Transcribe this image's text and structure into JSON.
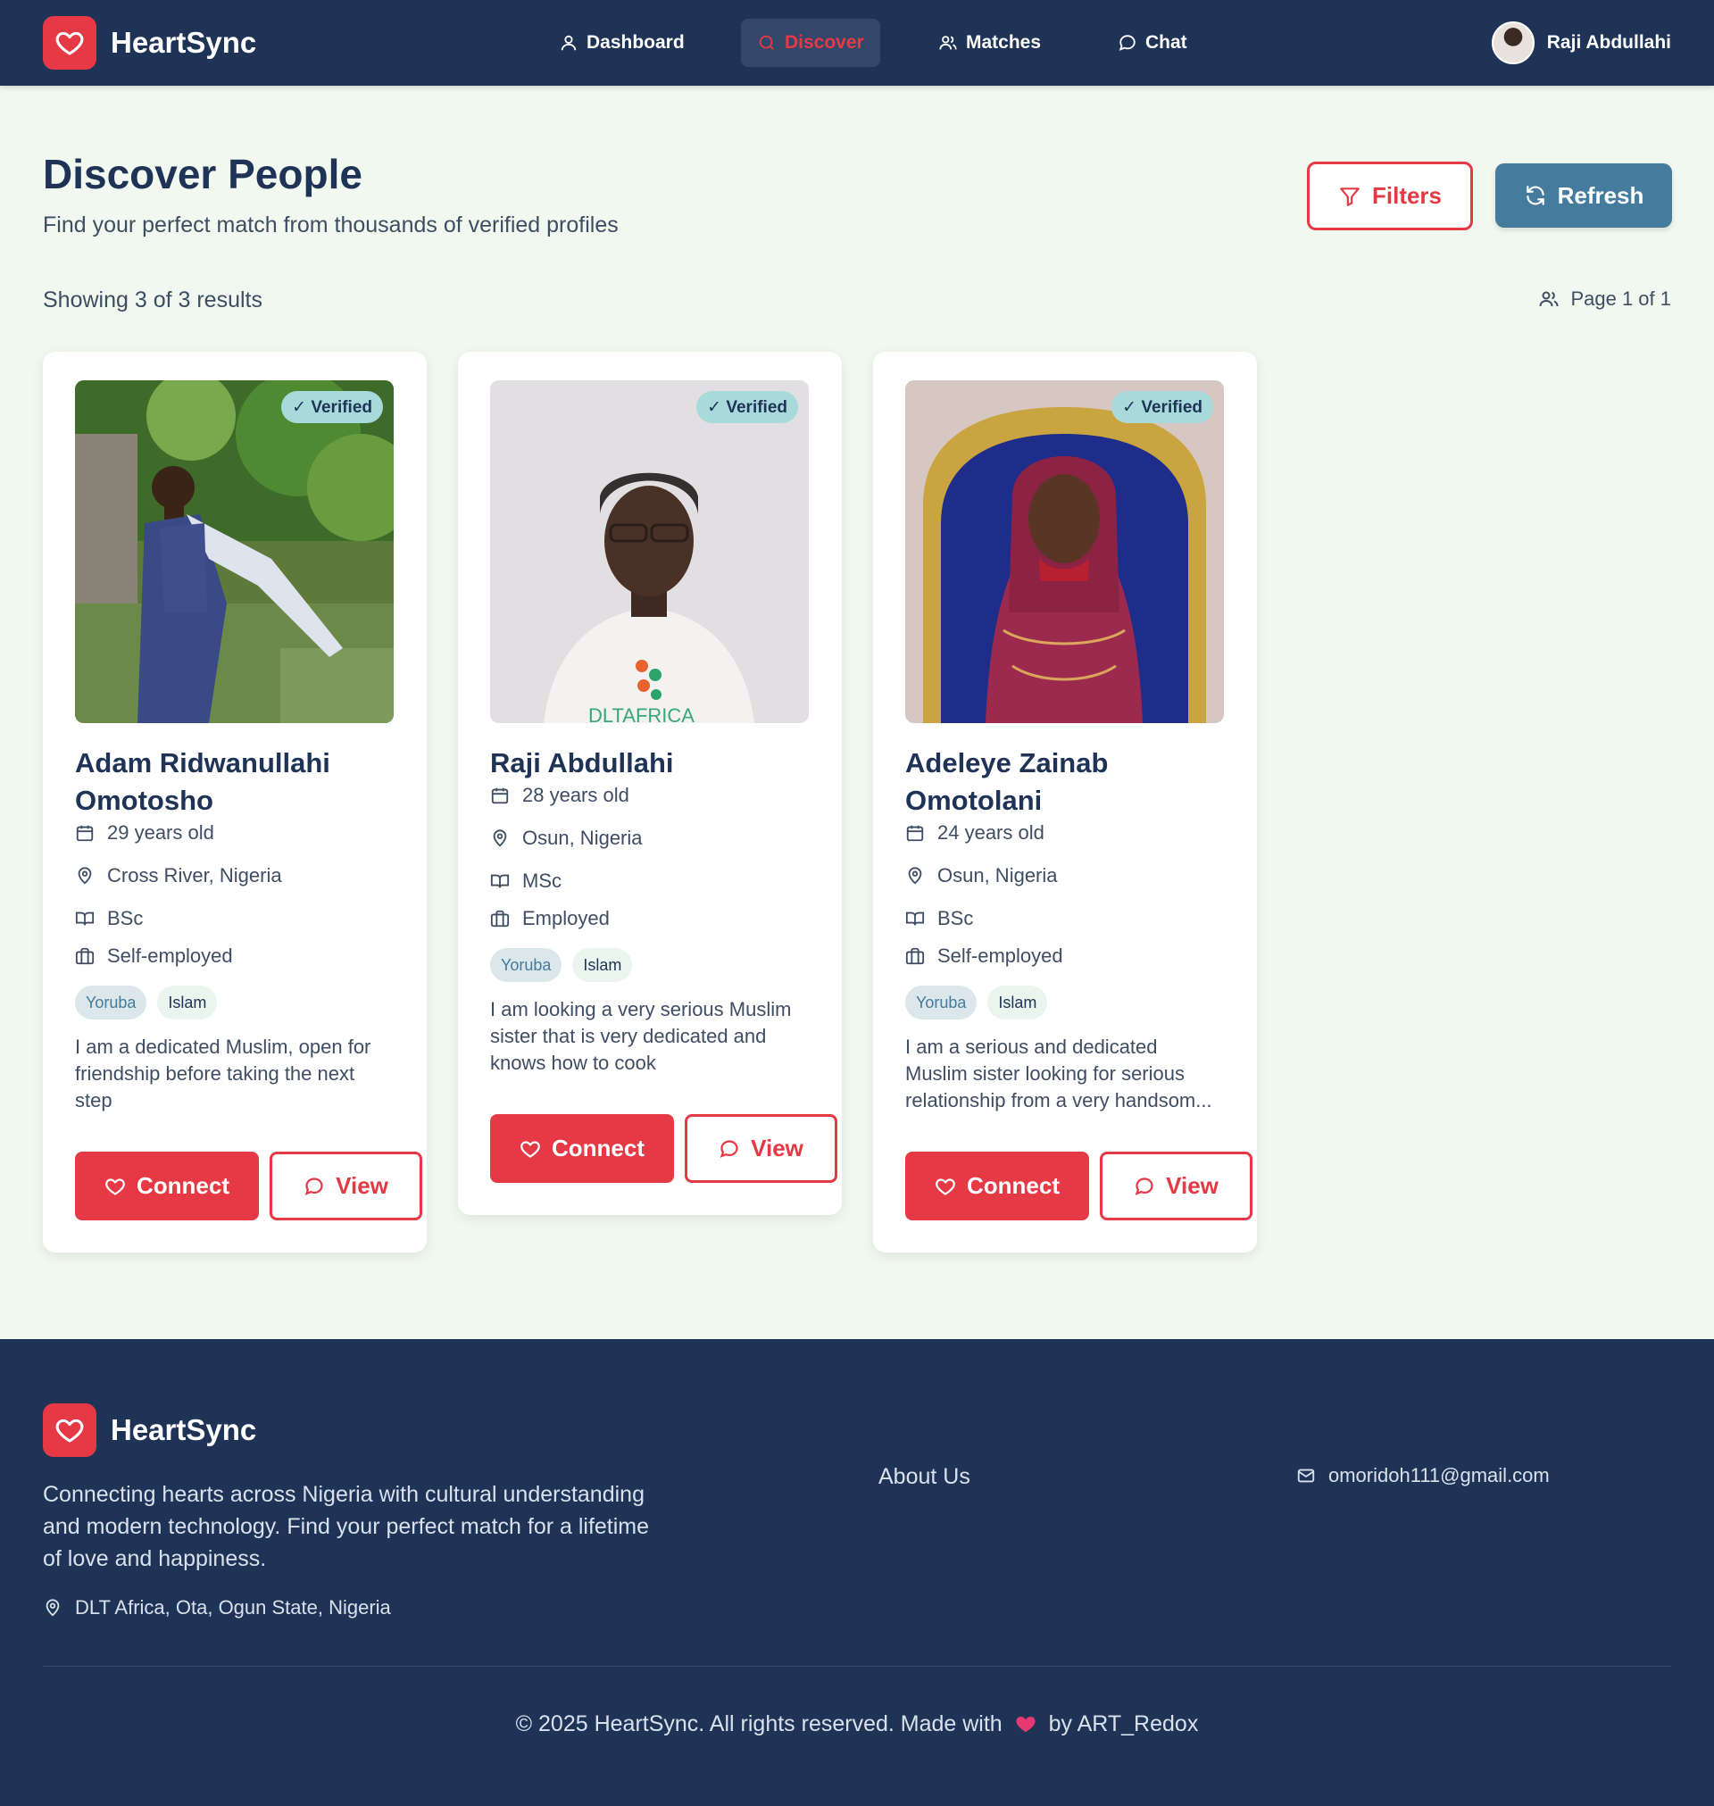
{
  "app": {
    "name": "HeartSync"
  },
  "nav": {
    "items": [
      {
        "label": "Dashboard",
        "icon": "user-icon"
      },
      {
        "label": "Discover",
        "icon": "search-icon",
        "active": true
      },
      {
        "label": "Matches",
        "icon": "users-icon"
      },
      {
        "label": "Chat",
        "icon": "chat-icon"
      }
    ],
    "user_name": "Raji Abdullahi"
  },
  "page": {
    "title": "Discover People",
    "subtitle": "Find your perfect match from thousands of verified profiles",
    "filters_label": "Filters",
    "refresh_label": "Refresh",
    "results_text": "Showing 3 of 3 results",
    "page_info": "Page 1 of 1"
  },
  "profiles": [
    {
      "badge": "✓ Verified",
      "name": "Adam Ridwanullahi Omotosho",
      "age": "29 years old",
      "location": "Cross River, Nigeria",
      "education": "BSc",
      "occupation": "Self-employed",
      "tags": [
        "Yoruba",
        "Islam"
      ],
      "bio": "I am a dedicated Muslim, open for friendship before taking the next step",
      "connect_label": "Connect",
      "view_label": "View"
    },
    {
      "badge": "✓ Verified",
      "name": "Raji Abdullahi",
      "age": "28 years old",
      "location": "Osun, Nigeria",
      "education": "MSc",
      "occupation": "Employed",
      "tags": [
        "Yoruba",
        "Islam"
      ],
      "bio": "I am looking a very serious Muslim sister that is very dedicated and knows how to cook",
      "connect_label": "Connect",
      "view_label": "View",
      "shirt_text": "DLTAFRICA"
    },
    {
      "badge": "✓ Verified",
      "name": "Adeleye Zainab Omotolani",
      "age": "24 years old",
      "location": "Osun, Nigeria",
      "education": "BSc",
      "occupation": "Self-employed",
      "tags": [
        "Yoruba",
        "Islam"
      ],
      "bio": "I am a serious and dedicated Muslim sister looking for serious relationship from a very handsom...",
      "connect_label": "Connect",
      "view_label": "View"
    }
  ],
  "footer": {
    "brand": "HeartSync",
    "description": "Connecting hearts across Nigeria with cultural understanding and modern technology. Find your perfect match for a lifetime of love and happiness.",
    "location": "DLT Africa, Ota, Ogun State, Nigeria",
    "about_label": "About Us",
    "email": "omoridoh111@gmail.com",
    "copyright_before": "© 2025 HeartSync. All rights reserved. Made with",
    "copyright_after": "by ART_Redox"
  },
  "colors": {
    "navy": "#1e3356",
    "accent_red": "#e63946",
    "steel_blue": "#457b9d",
    "verified_bg": "#a8dadc",
    "page_bg": "#f1f8ef"
  }
}
